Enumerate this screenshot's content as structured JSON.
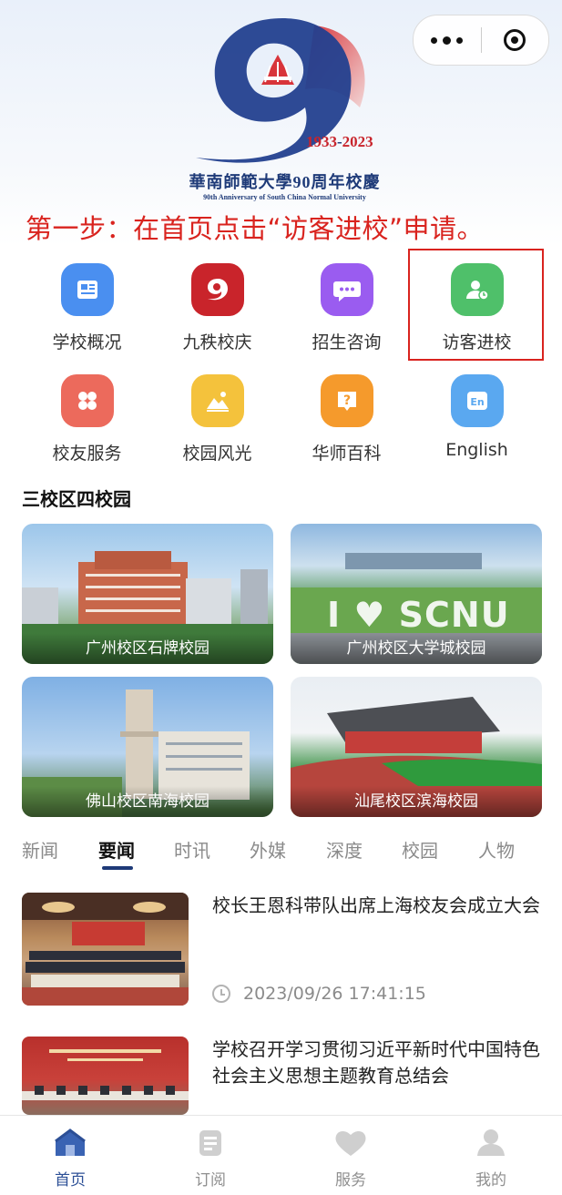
{
  "header": {
    "more_icon": "more-dots-icon",
    "close_icon": "target-circle-icon",
    "years": "1933-2023",
    "years_start": "1933",
    "years_end": "2023",
    "anniversary_title": "華南師範大學90周年校慶",
    "anniversary_en": "90th Anniversary of South China Normal University"
  },
  "instruction": "第一步：在首页点击“访客进校”申请。",
  "menu": [
    {
      "label": "学校概况",
      "icon": "newspaper-icon",
      "color": "#4a8ff0"
    },
    {
      "label": "九秩校庆",
      "icon": "anniversary-logo-icon",
      "color": "#c9242b"
    },
    {
      "label": "招生咨询",
      "icon": "chat-bubble-icon",
      "color": "#9a5cf0"
    },
    {
      "label": "访客进校",
      "icon": "visitor-user-icon",
      "color": "#4fc06a"
    },
    {
      "label": "校友服务",
      "icon": "clover-icon",
      "color": "#ec6a5c"
    },
    {
      "label": "校园风光",
      "icon": "landscape-icon",
      "color": "#f4c23c"
    },
    {
      "label": "华师百科",
      "icon": "question-icon",
      "color": "#f59a2c"
    },
    {
      "label": "English",
      "icon": "en-icon",
      "color": "#5aa8f0"
    }
  ],
  "campus_section": {
    "title": "三校区四校园",
    "items": [
      {
        "label": "广州校区石牌校园"
      },
      {
        "label": "广州校区大学城校园",
        "sign": "I ♥ SCNU"
      },
      {
        "label": "佛山校区南海校园"
      },
      {
        "label": "汕尾校区滨海校园"
      }
    ]
  },
  "news_tabs": [
    "新闻",
    "要闻",
    "时讯",
    "外媒",
    "深度",
    "校园",
    "人物"
  ],
  "active_tab": "要闻",
  "news": [
    {
      "title": "校长王恩科带队出席上海校友会成立大会",
      "time": "2023/09/26 17:41:15"
    },
    {
      "title": "学校召开学习贯彻习近平新时代中国特色社会主义思想主题教育总结会"
    }
  ],
  "tabbar": [
    {
      "label": "首页",
      "icon": "home-icon",
      "active": true
    },
    {
      "label": "订阅",
      "icon": "subscribe-doc-icon",
      "active": false
    },
    {
      "label": "服务",
      "icon": "heart-service-icon",
      "active": false
    },
    {
      "label": "我的",
      "icon": "user-profile-icon",
      "active": false
    }
  ],
  "colors": {
    "accent": "#d9231e",
    "brand_blue": "#1e3a78",
    "tab_active": "#2c4f96"
  }
}
